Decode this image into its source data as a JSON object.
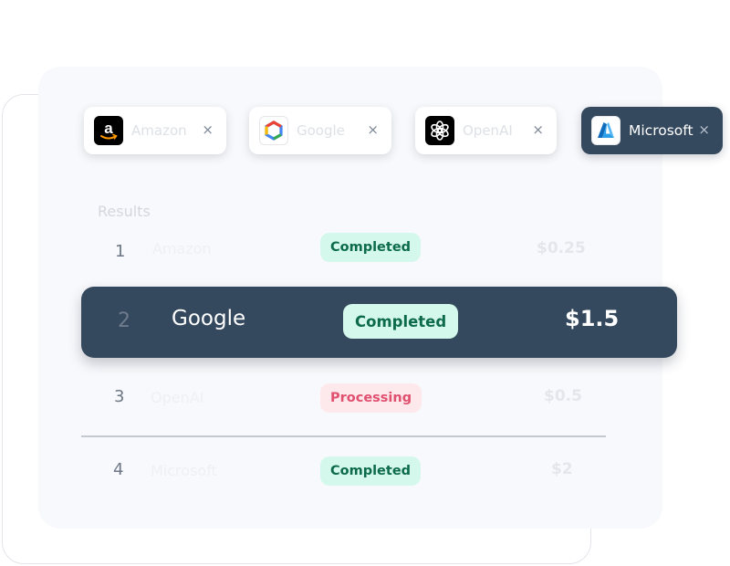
{
  "vendors": [
    {
      "name": "Amazon",
      "close": "×",
      "icon": "amazon-logo-icon"
    },
    {
      "name": "Google",
      "close": "×",
      "icon": "google-cloud-logo-icon"
    },
    {
      "name": "OpenAI",
      "close": "×",
      "icon": "openai-logo-icon"
    },
    {
      "name": "Microsoft",
      "close": "×",
      "icon": "azure-logo-icon",
      "active": true
    }
  ],
  "results": {
    "title": "Results",
    "rows": [
      {
        "rank": "1",
        "name": "Amazon",
        "status": "Completed",
        "price": "$0.25"
      },
      {
        "rank": "2",
        "name": "Google",
        "status": "Completed",
        "price": "$1.5",
        "highlighted": true
      },
      {
        "rank": "3",
        "name": "OpenAI",
        "status": "Processing",
        "price": "$0.5"
      },
      {
        "rank": "4",
        "name": "Microsoft",
        "status": "Completed",
        "price": "$2"
      }
    ]
  },
  "colors": {
    "active_background": "#35495e",
    "completed_bg": "#d4f8ec",
    "completed_text": "#0d6b4c",
    "processing_bg": "#fde8ec",
    "processing_text": "#e0506f"
  }
}
